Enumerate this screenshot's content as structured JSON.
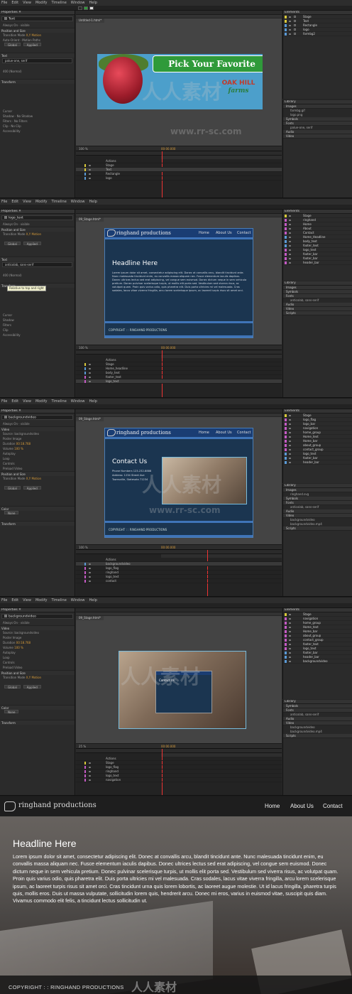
{
  "menu": [
    "File",
    "Edit",
    "View",
    "Modify",
    "Timeline",
    "Window",
    "Help"
  ],
  "screens": [
    {
      "tab": "Untitled-1.html*",
      "selected_name": "Text",
      "props": [
        "Always On",
        "visible",
        "Position and Size",
        "Transition Mode",
        "X,Y Motion",
        "Auto-Orient",
        "Motion Paths",
        "Global",
        "Applied",
        "Text",
        "palue-one, serif",
        "400 (Normal)",
        "Transform",
        "Cursor",
        "Shadow",
        "Filters",
        "Clip",
        "Accessibility",
        "No Shadow",
        "No Filters",
        "No Clip"
      ],
      "zoom": "100 %",
      "timecode": "00:00.000",
      "timeline_rows": [
        "Actions",
        "Stage",
        "Text",
        "Rectangle",
        "logo"
      ],
      "elements": [
        "Stage",
        "Text",
        "Rectangle",
        "logo",
        "farmbg2"
      ],
      "library": [
        "Images",
        "farmbg.gif",
        "logo.png",
        "Symbols",
        "Fonts",
        "palue-one, serif",
        "Audio",
        "Video"
      ],
      "banner_title": "Pick Your Favorite",
      "banner_logo_top": "OAK HILL",
      "banner_logo_bottom": "farms"
    },
    {
      "tab": "09_Stage.html*",
      "selected_name": "logo_text",
      "tooltip": "Relative to top and right",
      "props": [
        "Always On",
        "visible",
        "Position and Size",
        "Transition Mode",
        "X,Y Motion",
        "Global",
        "Applied",
        "Text",
        "anticolab, sans-serif",
        "400 (Normal)",
        "Transform",
        "Cursor",
        "Shadow",
        "Filters",
        "Clip",
        "Accessibility"
      ],
      "zoom": "100 %",
      "timecode": "00:00.000",
      "timeline_rows": [
        "Actions",
        "Stage",
        "Home_headline",
        "body_text",
        "footer_text",
        "logo_text"
      ],
      "elements": [
        "Stage",
        "ringhand",
        "Home",
        "About",
        "Contact",
        "Home_Headline",
        "body_text",
        "footer_text",
        "logo_text",
        "footer_bar",
        "footer_bar",
        "header_bar"
      ],
      "library": [
        "Images",
        "Symbols",
        "Fonts",
        "anticolab, sans-serif",
        "Audio",
        "Video",
        "Scripts"
      ],
      "brand": "ringhand productions",
      "nav": [
        "Home",
        "About Us",
        "Contact"
      ],
      "headline": "Headline Here",
      "body": "Lorem ipsum dolor sit amet, consectetur adipiscing elit. Donec at convallis arcu, blandit tincidunt ante. Nunc malesuada tincidunt enim, eu convallis massa aliquam nec. Fusce elementum iaculis dapibus. Donec ultrices lectus sed erat adipiscing, vel congue sem euismod. Donec dictum neque in sem vehicula pretium. Donec pulvinar scelerisque turpis, ut mollis elit porta sed. Vestibulum sed viverra risus, ac volutpat quam. Proin quis varius odio, quis pharetra elit. Duis porta ultricies mi vel malesuada. Cras sodales, lacus vitae viverra fringilla, arcu lorem scelerisque ipsum, ac laoreet turpis risus sit amet orci.",
      "footer": "COPYRIGHT : : RINGHAND PRODUCTIONS"
    },
    {
      "tab": "09_Stage.html*",
      "selected_name": "backgroundvideo",
      "props": [
        "Always On",
        "visible",
        "Video",
        "Source: backgroundvideo",
        "Poster Image",
        "Duration",
        "00:18.768",
        "Volume",
        "100 %",
        "Autoplay",
        "Loop",
        "Controls",
        "Preload Video",
        "Position and Size",
        "Transition Mode",
        "X,Y Motion",
        "Global",
        "Applied",
        "Color",
        "None",
        "Transform"
      ],
      "zoom": "100 %",
      "timecode": "00:00.000",
      "timeline_rows": [
        "Actions",
        "backgroundvideo",
        "logo_flag",
        "ringhand",
        "logo_text",
        "contact"
      ],
      "elements": [
        "Stage",
        "logo_flag",
        "logo_bar",
        "navigation",
        "home_group",
        "Home_text",
        "Home_bar",
        "about_group",
        "contact_group",
        "logo_text",
        "footer_bar",
        "header_bar"
      ],
      "library": [
        "Images",
        "ringhand.svg",
        "Symbols",
        "Fonts",
        "anticolab, sans-serif",
        "Audio",
        "Video",
        "backgroundvideo",
        "backgroundvideo.mp4",
        "Scripts"
      ],
      "brand": "ringhand productions",
      "nav": [
        "Home",
        "About Us",
        "Contact"
      ],
      "headline": "Contact Us",
      "contact_lines": [
        "Phone Numbers 123-232-8888",
        "Address: 1234 Street Ave",
        "Townsville, Statesota 71234"
      ],
      "footer": "COPYRIGHT : : RINGHAND PRODUCTIONS"
    },
    {
      "tab": "09_Stage.html*",
      "selected_name": "backgroundvideo",
      "props": [
        "Always On",
        "visible",
        "Video",
        "Source: backgroundvideo",
        "Poster Image",
        "Duration",
        "00:18.768",
        "Volume",
        "100 %",
        "Autoplay",
        "Loop",
        "Controls",
        "Preload Video",
        "Position and Size",
        "Transition Mode",
        "X,Y Motion",
        "Global",
        "Applied",
        "Color",
        "None",
        "Transform"
      ],
      "zoom": "25 %",
      "timecode": "00:00.000",
      "timeline_rows": [
        "Actions",
        "Stage",
        "logo_flag",
        "ringhand",
        "logo_text",
        "navigation"
      ],
      "elements": [
        "Stage",
        "navigation",
        "home_group",
        "Home_text",
        "Home_bar",
        "about_group",
        "contact_group",
        "footer_text",
        "logo_text",
        "footer_bar",
        "header_bar",
        "backgroundvideo"
      ],
      "library": [
        "Symbols",
        "Fonts",
        "anticolab, sans-serif",
        "Audio",
        "Video",
        "backgroundvideo",
        "backgroundvideo.mp4",
        "Scripts"
      ]
    }
  ],
  "website": {
    "brand": "ringhand productions",
    "nav": [
      "Home",
      "About Us",
      "Contact"
    ],
    "headline": "Headline Here",
    "body": "Lorem ipsum dolor sit amet, consectetur adipiscing elit. Donec at convallis arcu, blandit tincidunt ante. Nunc malesuada tincidunt enim, eu convallis massa aliquam nec. Fusce elementum iaculis dapibus. Donec ultrices lectus sed erat adipiscing, vel congue sem euismod. Donec dictum neque in sem vehicula pretium. Donec pulvinar scelerisque turpis, ut mollis elit porta sed. Vestibulum sed viverra risus, ac volutpat quam. Proin quis varius odio, quis pharetra elit. Duis porta ultricies mi vel malesuada. Cras sodales, lacus vitae viverra fringilla, arcu lorem scelerisque ipsum, ac laoreet turpis risus sit amet orci. Cras tincidunt urna quis lorem lobortis, ac laoreet augue molestie. Ut id lacus fringilla, pharetra turpis quis, mollis eros. Duis ut massa vulputate, sollicitudin lorem quis, hendrerit arcu. Donec mi eros, varius in euismod vitae, suscipit quis diam. Vivamus commodo elit felis, a tincidunt lectus sollicitudin ut.",
    "footer": "COPYRIGHT : :  RINGHAND PRODUCTIONS"
  },
  "watermark": {
    "line1": "人人素材",
    "line2": "www.rr-sc.com"
  },
  "colors": {
    "accent": "#d69b3a",
    "selection": "#3f74b8",
    "banner_green": "#2f9a3a"
  }
}
